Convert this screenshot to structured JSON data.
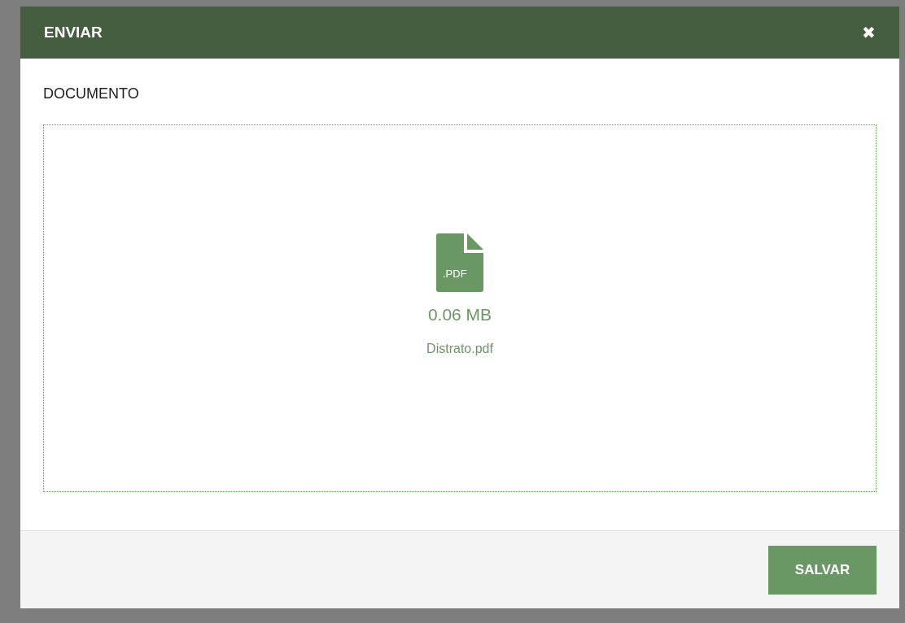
{
  "dialog": {
    "title": "ENVIAR",
    "close_icon": "✖",
    "section_label": "DOCUMENTO",
    "file": {
      "type_label": ".PDF",
      "size": "0.06 MB",
      "name": "Distrato.pdf"
    },
    "buttons": [
      "SALVAR"
    ]
  }
}
